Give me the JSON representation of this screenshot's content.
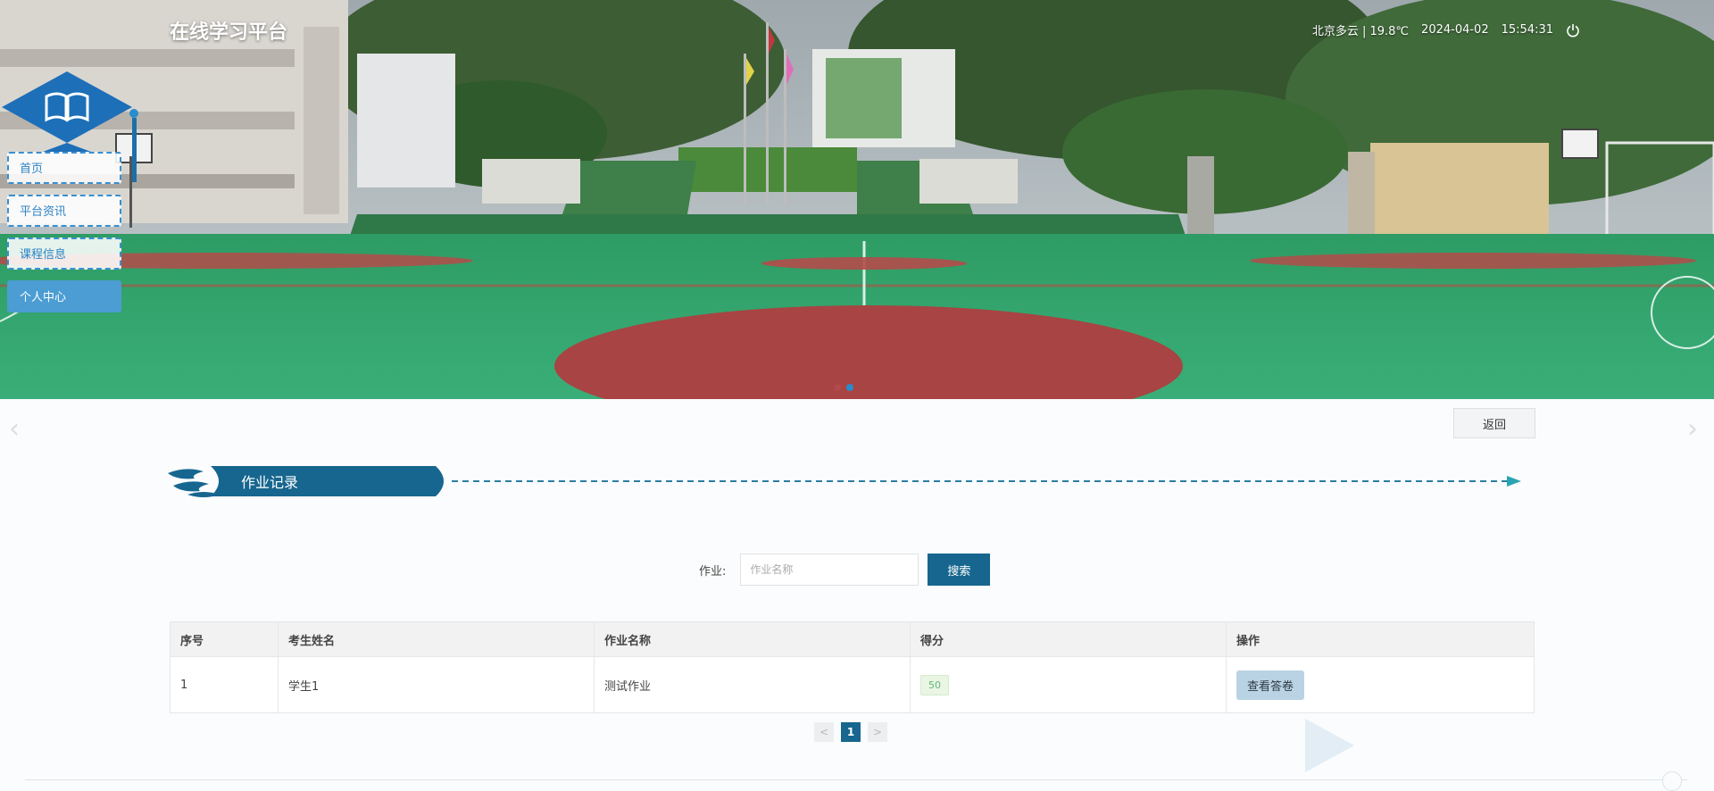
{
  "header": {
    "site_title": "在线学习平台",
    "weather": "北京多云 | 19.8℃",
    "date": "2024-04-02",
    "time": "15:54:31",
    "logout_icon": "power-icon"
  },
  "logo": {
    "icon": "book-icon"
  },
  "nav": {
    "items": [
      {
        "label": "首页",
        "active": false
      },
      {
        "label": "平台资讯",
        "active": false
      },
      {
        "label": "课程信息",
        "active": false
      },
      {
        "label": "个人中心",
        "active": true
      }
    ]
  },
  "carousel": {
    "slide_count": 2,
    "active_index": 1
  },
  "main": {
    "back_label": "返回",
    "section_title": "作业记录",
    "search": {
      "label": "作业:",
      "placeholder": "作业名称",
      "value": "",
      "button_label": "搜索"
    },
    "table": {
      "columns": [
        "序号",
        "考生姓名",
        "作业名称",
        "得分",
        "操作"
      ],
      "rows": [
        {
          "index": "1",
          "student_name": "学生1",
          "homework_name": "测试作业",
          "score": "50",
          "action_label": "查看答卷"
        }
      ]
    },
    "pagination": {
      "prev": "<",
      "current": "1",
      "next": ">"
    }
  },
  "colors": {
    "primary": "#16668f",
    "accent": "#2c83c4",
    "score_green": "#5fb878"
  }
}
